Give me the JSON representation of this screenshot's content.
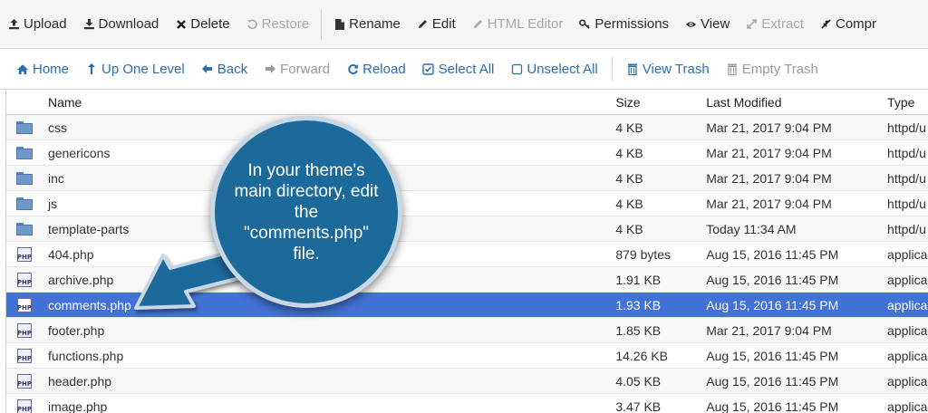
{
  "toolbar": {
    "items": [
      {
        "label": "Upload",
        "icon": "upload-icon",
        "disabled": false
      },
      {
        "label": "Download",
        "icon": "download-icon",
        "disabled": false
      },
      {
        "label": "Delete",
        "icon": "delete-icon",
        "disabled": false
      },
      {
        "label": "Restore",
        "icon": "restore-icon",
        "disabled": true
      },
      {
        "label": "Rename",
        "icon": "rename-icon",
        "disabled": false
      },
      {
        "label": "Edit",
        "icon": "edit-icon",
        "disabled": false
      },
      {
        "label": "HTML Editor",
        "icon": "html-editor-icon",
        "disabled": true
      },
      {
        "label": "Permissions",
        "icon": "key-icon",
        "disabled": false
      },
      {
        "label": "View",
        "icon": "eye-icon",
        "disabled": false
      },
      {
        "label": "Extract",
        "icon": "extract-icon",
        "disabled": true
      },
      {
        "label": "Compr",
        "icon": "compress-icon",
        "disabled": false
      }
    ]
  },
  "nav": {
    "items": [
      {
        "label": "Home",
        "icon": "home-icon",
        "disabled": false
      },
      {
        "label": "Up One Level",
        "icon": "up-level-icon",
        "disabled": false
      },
      {
        "label": "Back",
        "icon": "back-arrow-icon",
        "disabled": false
      },
      {
        "label": "Forward",
        "icon": "forward-arrow-icon",
        "disabled": true
      },
      {
        "label": "Reload",
        "icon": "reload-icon",
        "disabled": false
      },
      {
        "label": "Select All",
        "icon": "checkbox-checked-icon",
        "disabled": false
      },
      {
        "label": "Unselect All",
        "icon": "checkbox-empty-icon",
        "disabled": false
      },
      {
        "label": "View Trash",
        "icon": "trash-icon",
        "disabled": false
      },
      {
        "label": "Empty Trash",
        "icon": "trash-icon",
        "disabled": true
      }
    ]
  },
  "table": {
    "headers": {
      "name": "Name",
      "size": "Size",
      "modified": "Last Modified",
      "type": "Type"
    },
    "rows": [
      {
        "kind": "folder",
        "name": "css",
        "size": "4 KB",
        "modified": "Mar 21, 2017 9:04 PM",
        "type": "httpd/u",
        "selected": false
      },
      {
        "kind": "folder",
        "name": "genericons",
        "size": "4 KB",
        "modified": "Mar 21, 2017 9:04 PM",
        "type": "httpd/u",
        "selected": false
      },
      {
        "kind": "folder",
        "name": "inc",
        "size": "4 KB",
        "modified": "Mar 21, 2017 9:04 PM",
        "type": "httpd/u",
        "selected": false
      },
      {
        "kind": "folder",
        "name": "js",
        "size": "4 KB",
        "modified": "Mar 21, 2017 9:04 PM",
        "type": "httpd/u",
        "selected": false
      },
      {
        "kind": "folder",
        "name": "template-parts",
        "size": "4 KB",
        "modified": "Today 11:34 AM",
        "type": "httpd/u",
        "selected": false
      },
      {
        "kind": "php",
        "name": "404.php",
        "size": "879 bytes",
        "modified": "Aug 15, 2016 11:45 PM",
        "type": "applica",
        "selected": false
      },
      {
        "kind": "php",
        "name": "archive.php",
        "size": "1.91 KB",
        "modified": "Aug 15, 2016 11:45 PM",
        "type": "applica",
        "selected": false
      },
      {
        "kind": "php",
        "name": "comments.php",
        "size": "1.93 KB",
        "modified": "Aug 15, 2016 11:45 PM",
        "type": "applica",
        "selected": true
      },
      {
        "kind": "php",
        "name": "footer.php",
        "size": "1.85 KB",
        "modified": "Mar 21, 2017 9:04 PM",
        "type": "applica",
        "selected": false
      },
      {
        "kind": "php",
        "name": "functions.php",
        "size": "14.26 KB",
        "modified": "Aug 15, 2016 11:45 PM",
        "type": "applica",
        "selected": false
      },
      {
        "kind": "php",
        "name": "header.php",
        "size": "4.05 KB",
        "modified": "Aug 15, 2016 11:45 PM",
        "type": "applica",
        "selected": false
      },
      {
        "kind": "php",
        "name": "image.php",
        "size": "3.47 KB",
        "modified": "Aug 15, 2016 11:45 PM",
        "type": "applica",
        "selected": false
      }
    ],
    "php_icon_text": "PHP"
  },
  "callout": {
    "text": "In your theme's main directory, edit the \"comments.php\" file."
  },
  "colors": {
    "selected_row": "#4372d6",
    "nav_link": "#2a6ead",
    "callout_fill": "#1c6a9b"
  }
}
